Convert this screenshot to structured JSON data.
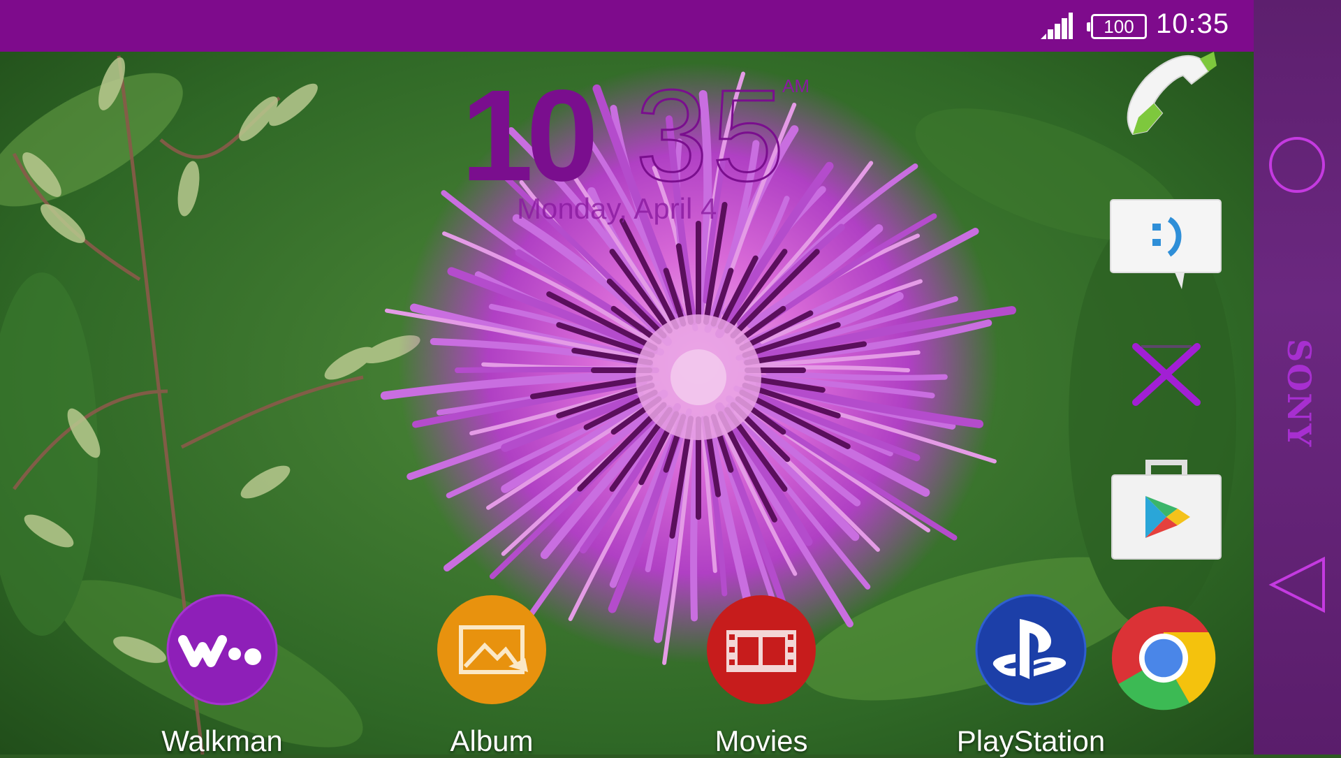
{
  "status_bar": {
    "battery_level": "100",
    "time": "10:35",
    "signal_icon": "signal-strength-icon",
    "background": "#7e0b8c"
  },
  "clock_widget": {
    "hours": "10",
    "minutes": "35",
    "ampm": "AM",
    "date": "Monday, April 4",
    "color": "#7a0e8e"
  },
  "dock": {
    "items": [
      {
        "name": "phone",
        "icon": "phone-handset-icon"
      },
      {
        "name": "messaging",
        "icon": "chat-bubble-icon"
      },
      {
        "name": "xperia",
        "icon": "x-logo-icon"
      },
      {
        "name": "play-store",
        "icon": "shopping-bag-play-icon"
      }
    ]
  },
  "nav_bar": {
    "brand": "SONY",
    "home_icon": "home-circle-icon",
    "back_icon": "back-triangle-icon",
    "accent": "#c43ae0"
  },
  "apps": [
    {
      "label": "Walkman",
      "icon": "walkman-icon",
      "color": "#8e1fb8"
    },
    {
      "label": "Album",
      "icon": "album-photo-icon",
      "color": "#e8920e"
    },
    {
      "label": "Movies",
      "icon": "film-strip-icon",
      "color": "#c71c1c"
    },
    {
      "label": "PlayStation",
      "icon": "playstation-icon",
      "color": "#1c3fa8"
    },
    {
      "label": "",
      "icon": "chrome-icon",
      "color": "#4a86e8"
    }
  ]
}
